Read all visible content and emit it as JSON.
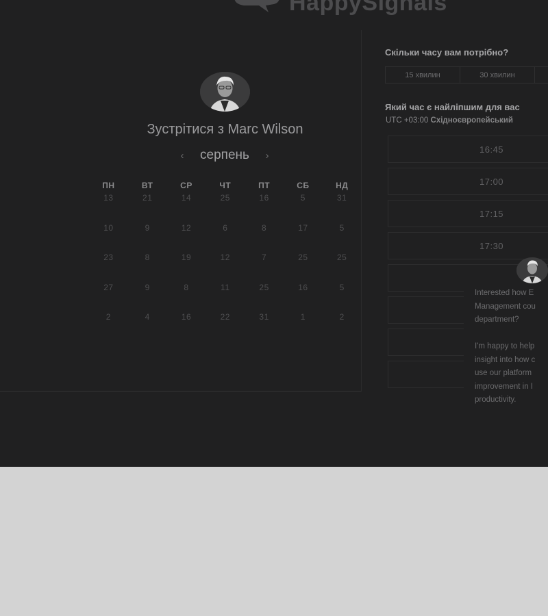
{
  "brand": {
    "name": "HappySignals"
  },
  "host": {
    "title": "Зустрітися з Marc Wilson"
  },
  "calendar": {
    "month": "серпень",
    "weekdays": [
      "ПН",
      "ВТ",
      "СР",
      "ЧТ",
      "ПТ",
      "СБ",
      "НД"
    ],
    "weeks": [
      [
        "13",
        "21",
        "14",
        "25",
        "16",
        "5",
        "31"
      ],
      [
        "10",
        "9",
        "12",
        "6",
        "8",
        "17",
        "5"
      ],
      [
        "23",
        "8",
        "19",
        "12",
        "7",
        "25",
        "25"
      ],
      [
        "27",
        "9",
        "8",
        "11",
        "25",
        "16",
        "5"
      ],
      [
        "2",
        "4",
        "16",
        "22",
        "31",
        "1",
        "2"
      ]
    ]
  },
  "scheduler": {
    "duration_question": "Скільки часу вам потрібно?",
    "durations": [
      "15 хвилин",
      "30 хвилин"
    ],
    "time_question": "Який час є найліпшим для вас",
    "timezone_offset": "UTC +03:00",
    "timezone_name": "Східноєвропейський",
    "slots": [
      "16:45",
      "17:00",
      "17:15",
      "17:30",
      "",
      "",
      "",
      ""
    ]
  },
  "chat": {
    "message": "Interested how E\nManagement cou\ndepartment?\n\nI'm happy to help\ninsight into how c\nuse our platform\nimprovement in I\nproductivity."
  }
}
